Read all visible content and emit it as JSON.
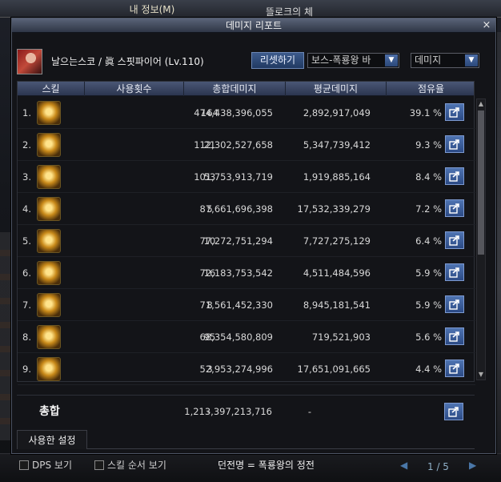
{
  "background": {
    "title": "내 정보(M)",
    "title2": "뜰로크의 체"
  },
  "dialog": {
    "title": "데미지 리포트",
    "close_icon": "×"
  },
  "header": {
    "character": "날으는스코 / 眞 스핏파이어 (Lv.110)",
    "reset_label": "리셋하기",
    "boss_select": "보스-폭룡왕 바",
    "metric_select": "데미지"
  },
  "columns": [
    "스킬",
    "사용횟수",
    "총합데미지",
    "평균데미지",
    "점유율"
  ],
  "rows": [
    {
      "rank": "1.",
      "count": "164",
      "total": "474,438,396,055",
      "avg": "2,892,917,049",
      "share": "39.1 %"
    },
    {
      "rank": "2.",
      "count": "21",
      "total": "112,302,527,658",
      "avg": "5,347,739,412",
      "share": "9.3 %"
    },
    {
      "rank": "3.",
      "count": "53",
      "total": "101,753,913,719",
      "avg": "1,919,885,164",
      "share": "8.4 %"
    },
    {
      "rank": "4.",
      "count": "5",
      "total": "87,661,696,398",
      "avg": "17,532,339,279",
      "share": "7.2 %"
    },
    {
      "rank": "5.",
      "count": "10",
      "total": "77,272,751,294",
      "avg": "7,727,275,129",
      "share": "6.4 %"
    },
    {
      "rank": "6.",
      "count": "16",
      "total": "72,183,753,542",
      "avg": "4,511,484,596",
      "share": "5.9 %"
    },
    {
      "rank": "7.",
      "count": "8",
      "total": "71,561,452,330",
      "avg": "8,945,181,541",
      "share": "5.9 %"
    },
    {
      "rank": "8.",
      "count": "95",
      "total": "68,354,580,809",
      "avg": "719,521,903",
      "share": "5.6 %"
    },
    {
      "rank": "9.",
      "count": "3",
      "total": "52,953,274,996",
      "avg": "17,651,091,665",
      "share": "4.4 %"
    }
  ],
  "total": {
    "label": "총합",
    "count": "-",
    "total": "1,213,397,213,716",
    "avg": "-"
  },
  "settings_tab": "사용한 설정",
  "bottom": {
    "dps_label": "DPS 보기",
    "order_label": "스킬 순서 보기",
    "battle_label": "던전명 = 폭룡왕의 정전",
    "page": "1 / 5"
  },
  "colors": {
    "accent": "#2b4a85",
    "header": "#2c3650"
  },
  "icons": {
    "share": "share-icon",
    "skill": "skill-icon",
    "close": "close-icon"
  }
}
